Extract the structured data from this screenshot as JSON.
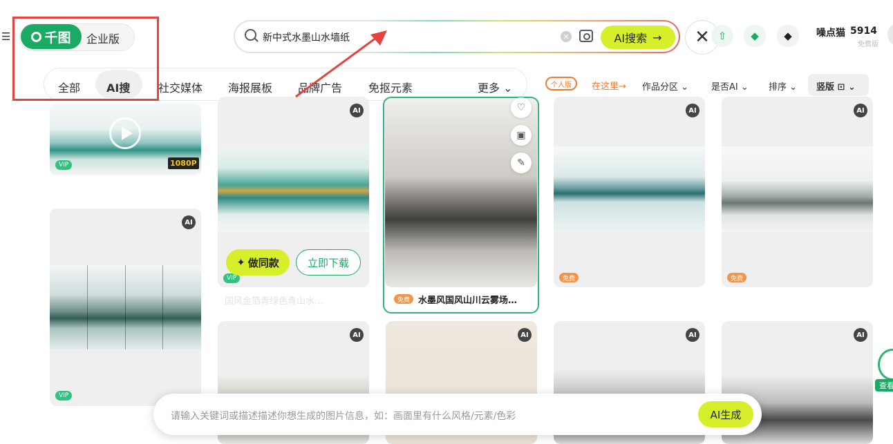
{
  "header": {
    "logo_text": "千图",
    "enterprise_label": "企业版",
    "search": {
      "value": "新中式水墨山水墙纸",
      "button_label": "AI搜索",
      "button_arrow": "→"
    },
    "close_symbol": "✕",
    "user": {
      "name": "噪点猫",
      "points": "5914",
      "badge": "免费版"
    },
    "icons": [
      "menu-icon",
      "upload-icon",
      "diamond-green-icon",
      "diamond-black-icon",
      "close-icon",
      "search-icon",
      "camera-icon",
      "clear-icon"
    ]
  },
  "categories": {
    "items": [
      "全部",
      "AI搜",
      "社交媒体",
      "海报展板",
      "品牌广告",
      "免抠元素"
    ],
    "more": "更多 ⌄"
  },
  "filters": {
    "personal_badge": "个人版",
    "here_text": "在这里→",
    "items": [
      "作品分区 ⌄",
      "是否AI ⌄",
      "排序 ⌄",
      "竖版 ⊡ ⌄"
    ]
  },
  "cards": {
    "video_card": {
      "tag": "VIP",
      "resolution": "1080P"
    },
    "card_screen": {
      "tag": "VIP"
    },
    "card_gold": {
      "tag": "VIP",
      "make_same_label": "做同款",
      "make_same_icon": "✦",
      "download_label": "立即下载",
      "caption": "国风金箔青绿色青山水…"
    },
    "card_ink": {
      "tag": "免费",
      "caption": "水墨风国风山川云雾场…"
    },
    "card_lake": {
      "tag": "免费"
    },
    "card_birds": {
      "tag": "免费"
    },
    "ai_badge_text": "AI"
  },
  "prompt": {
    "placeholder": "请输入关键词或描述描述你想生成的图片信息，如：画面里有什么风格/元素/色彩",
    "button": "AI生成"
  },
  "floating": {
    "check_label": "查看"
  },
  "annotation_color": "#e4433f",
  "accent_color": "#1aaa64",
  "highlight_color": "#d6ef2a"
}
